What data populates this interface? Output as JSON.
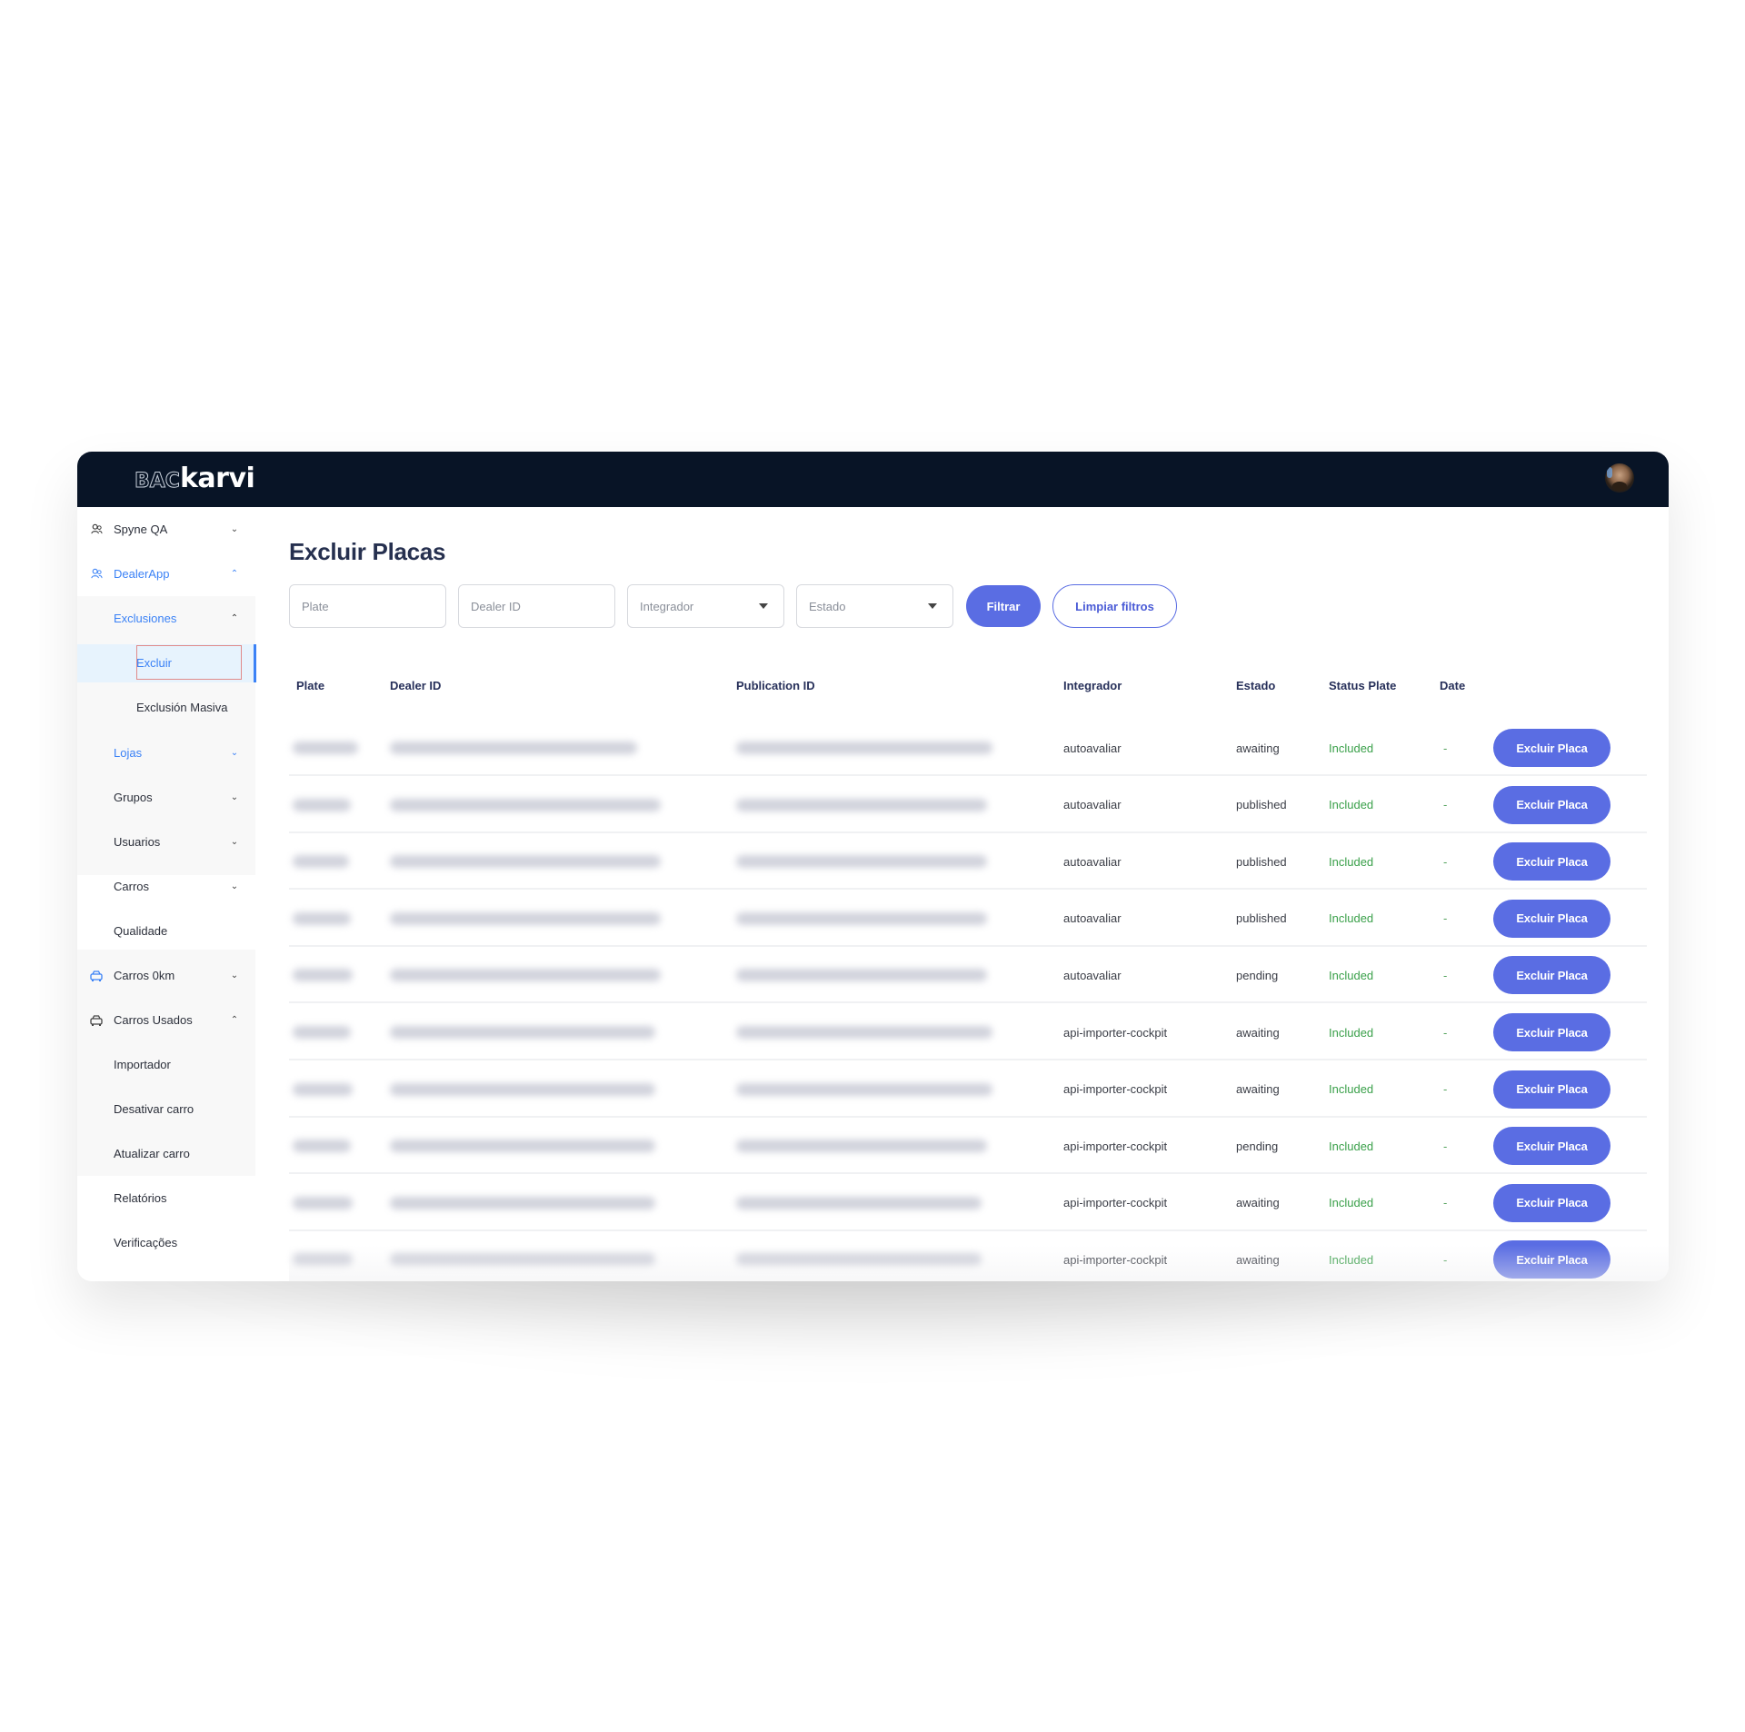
{
  "app": {
    "logo_prefix": "BAC",
    "logo_main": "karvi",
    "avatar_alt": "user-avatar"
  },
  "colors": {
    "topbar": "#081426",
    "accent": "#5a6de3",
    "link_blue": "#3b82f6",
    "status_green": "#3aa04a"
  },
  "sidebar": {
    "items": [
      {
        "label": "Spyne QA",
        "icon": "users-icon",
        "chevron": "down",
        "level": 0,
        "active": false
      },
      {
        "label": "DealerApp",
        "icon": "users-icon",
        "chevron": "up",
        "level": 0,
        "active": true
      },
      {
        "label": "Exclusiones",
        "chevron": "up",
        "level": 1,
        "active": true
      },
      {
        "label": "Excluir",
        "level": 2,
        "active": true,
        "selected": true
      },
      {
        "label": "Exclusión Masiva",
        "level": 2
      },
      {
        "label": "Lojas",
        "chevron": "down",
        "level": 1,
        "active": true
      },
      {
        "label": "Grupos",
        "chevron": "down",
        "level": 1
      },
      {
        "label": "Usuarios",
        "chevron": "down",
        "level": 1
      },
      {
        "label": "Carros",
        "chevron": "down",
        "level": 1
      },
      {
        "label": "Qualidade",
        "level": 1
      },
      {
        "label": "Carros 0km",
        "icon": "car-icon",
        "chevron": "down",
        "level": 0
      },
      {
        "label": "Carros Usados",
        "icon": "car-icon",
        "chevron": "up",
        "level": 0
      },
      {
        "label": "Importador",
        "level": 1
      },
      {
        "label": "Desativar carro",
        "level": 1
      },
      {
        "label": "Atualizar carro",
        "level": 1
      },
      {
        "label": "Relatórios",
        "level": 1
      },
      {
        "label": "Verificações",
        "level": 1
      }
    ]
  },
  "main": {
    "title": "Excluir Placas",
    "filters": {
      "plate_placeholder": "Plate",
      "plate_value": "",
      "dealer_placeholder": "Dealer ID",
      "dealer_value": "",
      "integrador_placeholder": "Integrador",
      "estado_placeholder": "Estado",
      "filter_button": "Filtrar",
      "clear_button": "Limpiar filtros"
    },
    "table": {
      "columns": [
        "Plate",
        "Dealer ID",
        "Publication ID",
        "Integrador",
        "Estado",
        "Status Plate",
        "Date"
      ],
      "action_label": "Excluir Placa",
      "rows": [
        {
          "plate": "[blurred]",
          "dealer_id": "[blurred]",
          "publication_id": "[blurred]",
          "integrador": "autoavaliar",
          "estado": "awaiting",
          "status_plate": "Included",
          "date": "-"
        },
        {
          "plate": "[blurred]",
          "dealer_id": "[blurred]",
          "publication_id": "[blurred]",
          "integrador": "autoavaliar",
          "estado": "published",
          "status_plate": "Included",
          "date": "-"
        },
        {
          "plate": "[blurred]",
          "dealer_id": "[blurred]",
          "publication_id": "[blurred]",
          "integrador": "autoavaliar",
          "estado": "published",
          "status_plate": "Included",
          "date": "-"
        },
        {
          "plate": "[blurred]",
          "dealer_id": "[blurred]",
          "publication_id": "[blurred]",
          "integrador": "autoavaliar",
          "estado": "published",
          "status_plate": "Included",
          "date": "-"
        },
        {
          "plate": "[blurred]",
          "dealer_id": "[blurred]",
          "publication_id": "[blurred]",
          "integrador": "autoavaliar",
          "estado": "pending",
          "status_plate": "Included",
          "date": "-"
        },
        {
          "plate": "[blurred]",
          "dealer_id": "[blurred]",
          "publication_id": "[blurred]",
          "integrador": "api-importer-cockpit",
          "estado": "awaiting",
          "status_plate": "Included",
          "date": "-"
        },
        {
          "plate": "[blurred]",
          "dealer_id": "[blurred]",
          "publication_id": "[blurred]",
          "integrador": "api-importer-cockpit",
          "estado": "awaiting",
          "status_plate": "Included",
          "date": "-"
        },
        {
          "plate": "[blurred]",
          "dealer_id": "[blurred]",
          "publication_id": "[blurred]",
          "integrador": "api-importer-cockpit",
          "estado": "pending",
          "status_plate": "Included",
          "date": "-"
        },
        {
          "plate": "[blurred]",
          "dealer_id": "[blurred]",
          "publication_id": "[blurred]",
          "integrador": "api-importer-cockpit",
          "estado": "awaiting",
          "status_plate": "Included",
          "date": "-"
        },
        {
          "plate": "[blurred]",
          "dealer_id": "[blurred]",
          "publication_id": "[blurred]",
          "integrador": "api-importer-cockpit",
          "estado": "awaiting",
          "status_plate": "Included",
          "date": "-"
        }
      ]
    }
  }
}
